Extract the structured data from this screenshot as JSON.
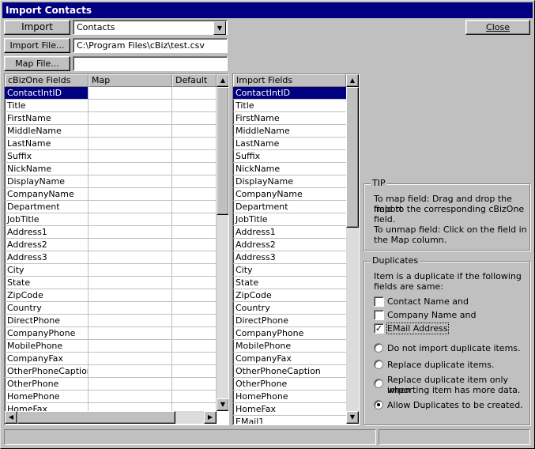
{
  "window": {
    "title": "Import Contacts"
  },
  "toolbar": {
    "import_label": "Import",
    "import_type": "Contacts",
    "import_file_label": "Import File...",
    "import_file_path": "C:\\Program Files\\cBiz\\test.csv",
    "map_file_label": "Map File...",
    "map_file_path": "",
    "close_label": "Close"
  },
  "left_grid": {
    "headers": [
      "cBizOne Fields",
      "Map",
      "Default"
    ],
    "rows": [
      "ContactIntID",
      "Title",
      "FirstName",
      "MiddleName",
      "LastName",
      "Suffix",
      "NickName",
      "DisplayName",
      "CompanyName",
      "Department",
      "JobTitle",
      "Address1",
      "Address2",
      "Address3",
      "City",
      "State",
      "ZipCode",
      "Country",
      "DirectPhone",
      "CompanyPhone",
      "MobilePhone",
      "CompanyFax",
      "OtherPhoneCaption",
      "OtherPhone",
      "HomePhone",
      "HomeFax"
    ],
    "selected_index": 0
  },
  "right_grid": {
    "header": "Import Fields",
    "rows": [
      "ContactIntID",
      "Title",
      "FirstName",
      "MiddleName",
      "LastName",
      "Suffix",
      "NickName",
      "DisplayName",
      "CompanyName",
      "Department",
      "JobTitle",
      "Address1",
      "Address2",
      "Address3",
      "City",
      "State",
      "ZipCode",
      "Country",
      "DirectPhone",
      "CompanyPhone",
      "MobilePhone",
      "CompanyFax",
      "OtherPhoneCaption",
      "OtherPhone",
      "HomePhone",
      "HomeFax",
      "EMail1"
    ],
    "selected_index": 0
  },
  "tip": {
    "legend": "TIP",
    "line1": "To map field: Drag and drop the import",
    "line2": "field to the corresponding cBizOne",
    "line3": "field.",
    "line4": "To unmap field: Click on the field in",
    "line5": "the Map column."
  },
  "duplicates": {
    "legend": "Duplicates",
    "intro1": "Item is a duplicate if the following",
    "intro2": "fields are same:",
    "checks": [
      {
        "label": "Contact Name and",
        "checked": false
      },
      {
        "label": "Company Name and",
        "checked": false
      },
      {
        "label": "EMail Address",
        "checked": true
      }
    ],
    "options": [
      {
        "label": "Do not import duplicate items.",
        "selected": false
      },
      {
        "label": "Replace duplicate items.",
        "selected": false
      },
      {
        "label": "Replace duplicate item only when",
        "label2": "importing item has more data.",
        "selected": false
      },
      {
        "label": "Allow Duplicates to be created.",
        "selected": true
      }
    ]
  },
  "icons": {
    "combo_arrow": "chevron-down-icon",
    "scroll_up": "arrow-up-icon",
    "scroll_down": "arrow-down-icon",
    "scroll_left": "arrow-left-icon",
    "scroll_right": "arrow-right-icon",
    "check": "check-icon"
  },
  "colors": {
    "titlebar": "#000080",
    "selection": "#000080",
    "face": "#c0c0c0"
  }
}
